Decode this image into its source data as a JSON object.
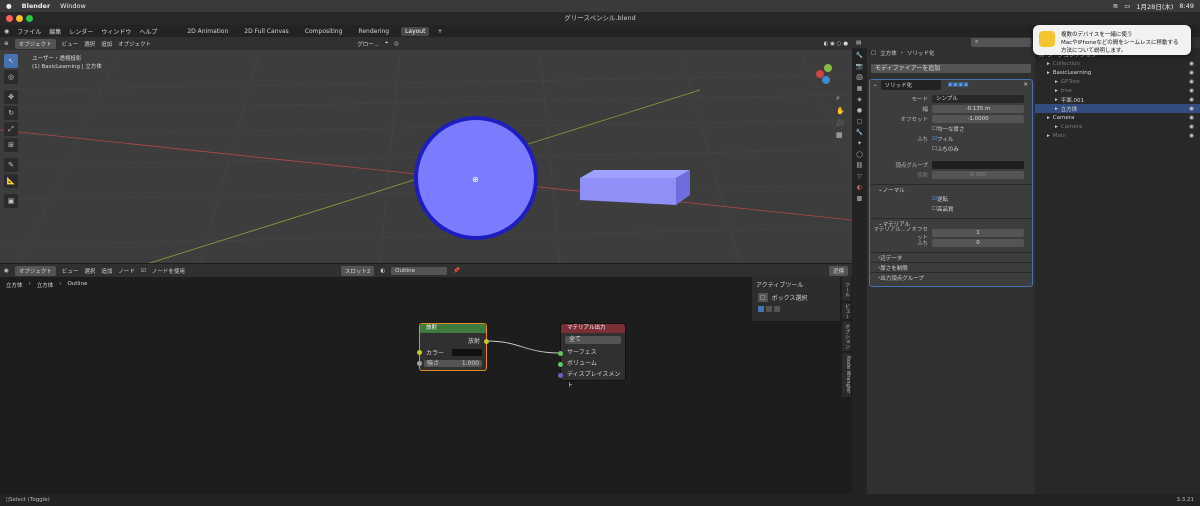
{
  "mac": {
    "app": "Blender",
    "menu_window": "Window",
    "date": "1月28日(木)",
    "time": "8:49"
  },
  "window_title": "グリースペンシル.blend",
  "menus": [
    "ファイル",
    "編集",
    "レンダー",
    "ウィンドウ",
    "ヘルプ"
  ],
  "workspaces": [
    "2D Animation",
    "2D Full Canvas",
    "Compositing",
    "Rendering",
    "Layout"
  ],
  "active_workspace": "Layout",
  "viewport": {
    "mode": "オブジェクト",
    "menus": [
      "ビュー",
      "選択",
      "追加",
      "オブジェクト"
    ],
    "orient": "グロー...",
    "info_line1": "ユーザー・透視投影",
    "info_line2": "(1) BasicLearning | 立方体"
  },
  "node_header": {
    "mode": "オブジェクト",
    "menus": [
      "ビュー",
      "選択",
      "追加",
      "ノード"
    ],
    "use_nodes": "ノードを使用",
    "slot": "スロット2",
    "material": "Outline",
    "view_label": "近傍"
  },
  "breadcrumb": [
    "立方体",
    "立方体",
    "Outline"
  ],
  "emission_node": {
    "title": "放射",
    "output": "放射",
    "color_label": "カラー",
    "strength_label": "強さ",
    "strength_value": "1.000"
  },
  "material_output_node": {
    "title": "マテリアル出力",
    "target": "全て",
    "inputs": [
      "サーフェス",
      "ボリューム",
      "ディスプレイスメント"
    ]
  },
  "tools_panel": {
    "title": "アクティブツール",
    "tool": "ボックス選択",
    "tabs": [
      "ツール",
      "ビュー",
      "オプション",
      "Node Wrangler"
    ]
  },
  "properties": {
    "object": "立方体",
    "modifier_name_field": "ソリッド化",
    "add_modifier": "モディファイアーを追加",
    "modifier_name": "ソリッド化",
    "rows": [
      {
        "label": "モード",
        "value": "シンプル"
      },
      {
        "label": "幅",
        "value": "-0.135 m"
      },
      {
        "label": "オフセット",
        "value": "-1.0000"
      }
    ],
    "even_thickness": "均一な厚さ",
    "rim_label": "ふち",
    "fill": "フィル",
    "rim_only": "ふちのみ",
    "vertex_group": "頂点グループ",
    "factor_label": "係数",
    "factor_value": "0.000",
    "normals_section": "ノーマル",
    "flip": "逆転",
    "high_quality": "高品質",
    "material_section": "マテリアル",
    "material_offset_label": "マテリアル...ノオフセット",
    "material_offset_value": "1",
    "rim_offset_label": "ふち",
    "rim_offset_value": "0",
    "collapsed": [
      "辺データ",
      "厚さを制限",
      "出力頂点グループ"
    ]
  },
  "outliner": {
    "title": "シーンコレクション",
    "items": [
      {
        "label": "Collection",
        "indent": 1,
        "dim": true
      },
      {
        "label": "BasicLearning",
        "indent": 1,
        "dim": false
      },
      {
        "label": "GPTree",
        "indent": 2,
        "dim": true
      },
      {
        "label": "tree",
        "indent": 2,
        "dim": true
      },
      {
        "label": "平面.001",
        "indent": 2,
        "dim": false
      },
      {
        "label": "立方体",
        "indent": 2,
        "dim": false,
        "selected": true
      },
      {
        "label": "Camera",
        "indent": 1,
        "dim": false
      },
      {
        "label": "Camera",
        "indent": 2,
        "dim": true
      },
      {
        "label": "Main",
        "indent": 1,
        "dim": true
      }
    ]
  },
  "notification": {
    "line1": "複数のデバイスを一緒に使う",
    "line2": "MacやiPhoneなどの間をシームレスに移動する",
    "line3": "方法について説明します。"
  },
  "status": {
    "left": "Select (Toggle)",
    "version": "3.3.21"
  },
  "colors": {
    "accent": "#4772b3",
    "emission_header": "#3f7a3f",
    "output_header": "#7a2f36",
    "sphere": "#7b7bff"
  }
}
